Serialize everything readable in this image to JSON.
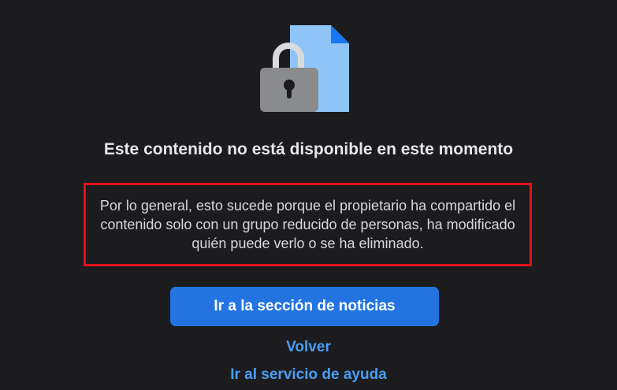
{
  "content_unavailable": {
    "icon": "lock-document-icon",
    "title": "Este contenido no está disponible en este momento",
    "message": "Por lo general, esto sucede porque el propietario ha compartido el contenido solo con un grupo reducido de personas, ha modificado quién puede verlo o se ha eliminado.",
    "highlight_color": "#e0111b",
    "primary_button_label": "Ir a la sección de noticias",
    "back_link": "Volver",
    "help_link": "Ir al servicio de ayuda"
  },
  "colors": {
    "background": "#1c1c1e",
    "button": "#2374e1",
    "link": "#4a9ef6"
  }
}
